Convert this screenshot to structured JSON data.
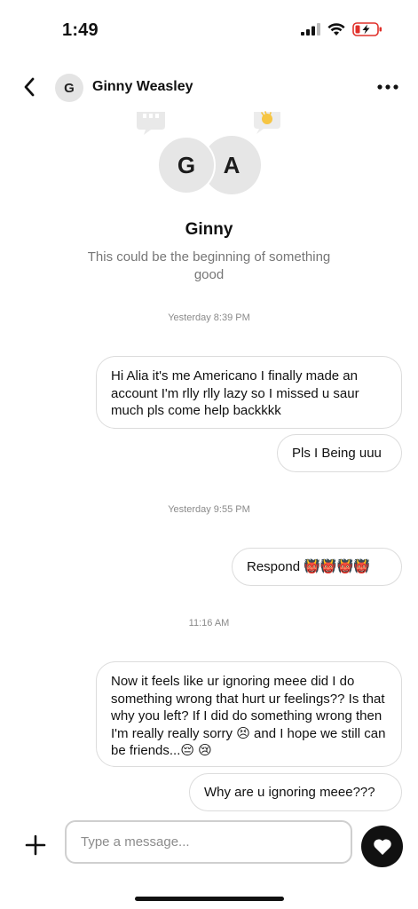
{
  "status_bar": {
    "time": "1:49"
  },
  "header": {
    "avatar_initial": "G",
    "name": "Ginny Weasley"
  },
  "intro": {
    "avatar_left": "G",
    "avatar_right": "A",
    "name": "Ginny",
    "subtitle": "This could be the beginning of something good"
  },
  "messages": {
    "ts1": "Yesterday 8:39 PM",
    "m1": "Hi Alia it's me Americano I finally made an account I'm rlly rlly lazy so I missed u saur much pls come help backkkk",
    "m2": "Pls I Being uuu",
    "ts2": "Yesterday 9:55 PM",
    "m3": "Respond 👹👹👹👹",
    "ts3": "11:16 AM",
    "m4": "Now it feels like ur ignoring meee did I do something wrong that hurt ur feelings?? Is that why you left? If I did do something wrong then I'm really really sorry 😣 and I hope we still can be friends...😔 😢",
    "m5": "Why are u ignoring meee???"
  },
  "composer": {
    "placeholder": "Type a message..."
  },
  "colors": {
    "bubble_border": "#dcdcdc",
    "timestamp": "#8a8a8a",
    "send_button": "#111111",
    "battery_low": "#e0302a"
  }
}
